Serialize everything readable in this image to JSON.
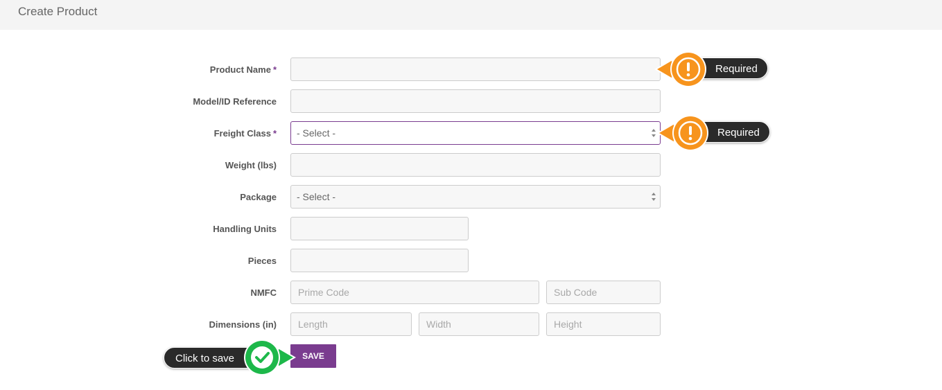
{
  "header": {
    "title": "Create Product"
  },
  "form": {
    "required_mark": "*",
    "product_name": {
      "label": "Product Name",
      "value": ""
    },
    "model_ref": {
      "label": "Model/ID Reference",
      "value": ""
    },
    "freight_class": {
      "label": "Freight Class",
      "selected": "- Select -"
    },
    "weight": {
      "label": "Weight (lbs)",
      "value": ""
    },
    "package": {
      "label": "Package",
      "selected": "- Select -"
    },
    "handling_units": {
      "label": "Handling Units",
      "value": ""
    },
    "pieces": {
      "label": "Pieces",
      "value": ""
    },
    "nmfc": {
      "label": "NMFC",
      "prime_placeholder": "Prime Code",
      "sub_placeholder": "Sub Code"
    },
    "dimensions": {
      "label": "Dimensions (in)",
      "length_placeholder": "Length",
      "width_placeholder": "Width",
      "height_placeholder": "Height"
    },
    "save_label": "SAVE"
  },
  "callouts": {
    "required_label": "Required",
    "save_hint": "Click to save",
    "warning_color": "#f7941d",
    "success_color": "#1db84a"
  }
}
